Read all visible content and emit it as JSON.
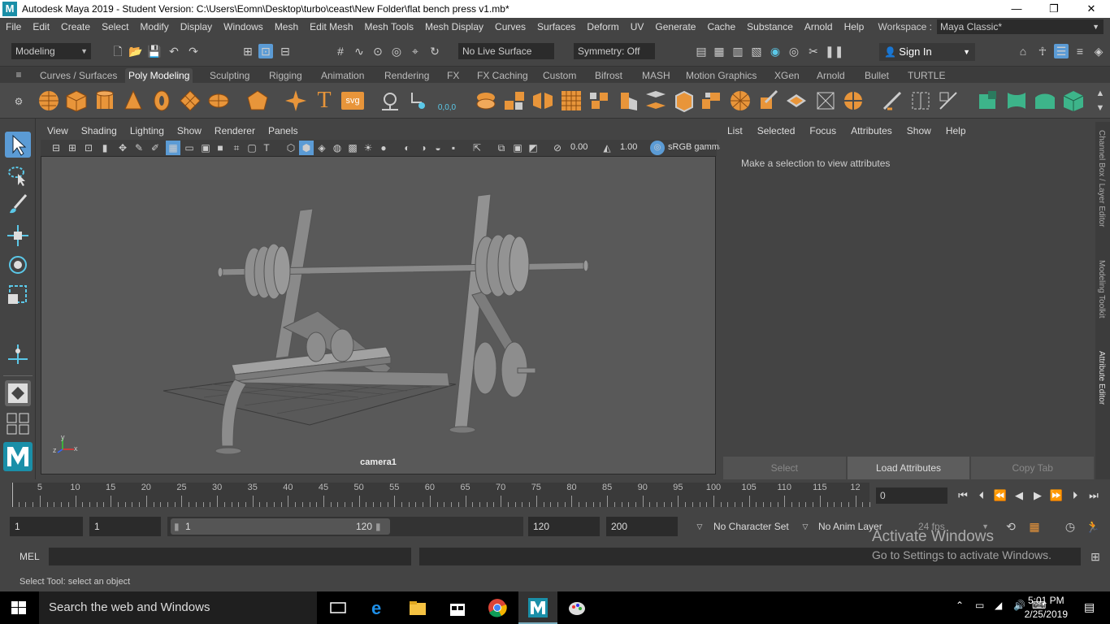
{
  "window": {
    "app_icon": "M",
    "title": "Autodesk Maya 2019 - Student Version: C:\\Users\\Eomn\\Desktop\\turbo\\ceast\\New Folder\\flat bench press v1.mb*",
    "minimize": "—",
    "restore": "❐",
    "close": "✕"
  },
  "menubar": {
    "items": [
      "File",
      "Edit",
      "Create",
      "Select",
      "Modify",
      "Display",
      "Windows",
      "Mesh",
      "Edit Mesh",
      "Mesh Tools",
      "Mesh Display",
      "Curves",
      "Surfaces",
      "Deform",
      "UV",
      "Generate",
      "Cache",
      "Substance",
      "Arnold",
      "Help"
    ],
    "workspace_label": "Workspace :",
    "workspace_value": "Maya Classic*"
  },
  "statusline": {
    "mode": "Modeling",
    "live_surface": "No Live Surface",
    "symmetry": "Symmetry: Off",
    "sign_in": "Sign In"
  },
  "shelf": {
    "tabs": [
      "Curves / Surfaces",
      "Poly Modeling",
      "Sculpting",
      "Rigging",
      "Animation",
      "Rendering",
      "FX",
      "FX Caching",
      "Custom",
      "Bifrost",
      "MASH",
      "Motion Graphics",
      "XGen",
      "Arnold",
      "Bullet",
      "TURTLE"
    ],
    "active_tab": "Poly Modeling",
    "text_icon": "T",
    "svg_icon": "svg",
    "coord_icon": "0,0,0"
  },
  "viewport": {
    "menu": [
      "View",
      "Shading",
      "Lighting",
      "Show",
      "Renderer",
      "Panels"
    ],
    "exposure": "0.00",
    "gamma": "1.00",
    "color_space": "sRGB gamma",
    "camera": "camera1",
    "axis_x": "x",
    "axis_y": "y",
    "axis_z": "z"
  },
  "attribute_editor": {
    "menu": [
      "List",
      "Selected",
      "Focus",
      "Attributes",
      "Show",
      "Help"
    ],
    "message": "Make a selection to view attributes",
    "buttons": [
      "Select",
      "Load Attributes",
      "Copy Tab"
    ],
    "side_tabs": [
      "Channel Box / Layer Editor",
      "Modeling Toolkit",
      "Attribute Editor"
    ]
  },
  "timeslider": {
    "ticks": [
      "5",
      "10",
      "15",
      "20",
      "25",
      "30",
      "35",
      "40",
      "45",
      "50",
      "55",
      "60",
      "65",
      "70",
      "75",
      "80",
      "85",
      "90",
      "95",
      "100",
      "105",
      "110",
      "115",
      "12"
    ],
    "current_frame": "0"
  },
  "range": {
    "start": "1",
    "anim_start": "1",
    "slider_start": "1",
    "slider_end": "120",
    "anim_end": "120",
    "end": "200",
    "character_set": "No Character Set",
    "anim_layer": "No Anim Layer",
    "fps": "24 fps"
  },
  "cmdline": {
    "label": "MEL"
  },
  "helpline": "Select Tool: select an object",
  "watermark": {
    "line1": "Activate Windows",
    "line2": "Go to Settings to activate Windows."
  },
  "taskbar": {
    "search": "Search the web and Windows",
    "time": "5:01 PM",
    "date": "2/25/2019"
  },
  "colors": {
    "shelf_orange": "#e8953a",
    "shelf_green": "#3db48a",
    "tool_active": "#5b9bd5"
  }
}
